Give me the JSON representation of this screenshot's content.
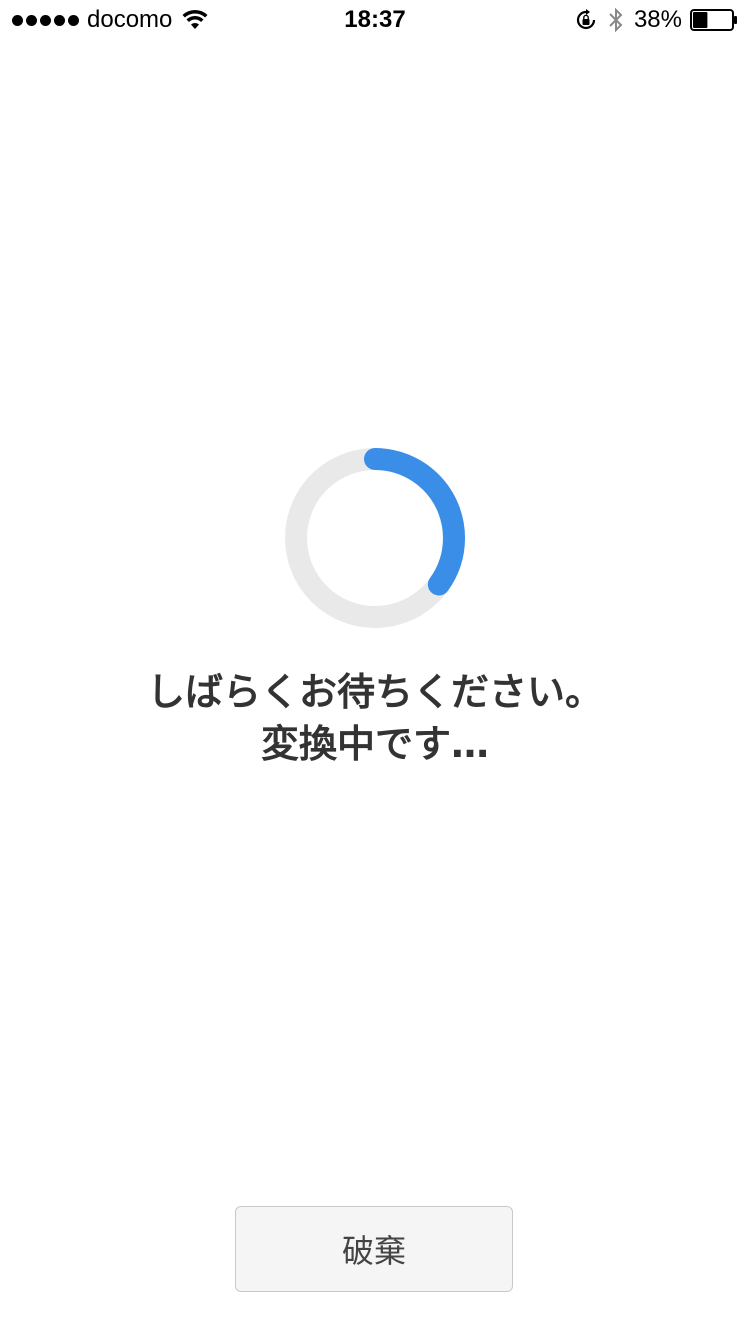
{
  "status_bar": {
    "carrier": "docomo",
    "time": "18:37",
    "battery_percent": "38%",
    "battery_level": 0.38,
    "signal_bars": 5,
    "icons": [
      "wifi-icon",
      "rotation-lock-icon",
      "bluetooth-icon",
      "battery-icon"
    ]
  },
  "progress": {
    "value": 0.35,
    "track_color": "#e9e9e9",
    "fill_color": "#3a8ee8"
  },
  "message": {
    "line1": "しばらくお待ちください。",
    "line2": "変換中です…"
  },
  "actions": {
    "discard_label": "破棄"
  }
}
